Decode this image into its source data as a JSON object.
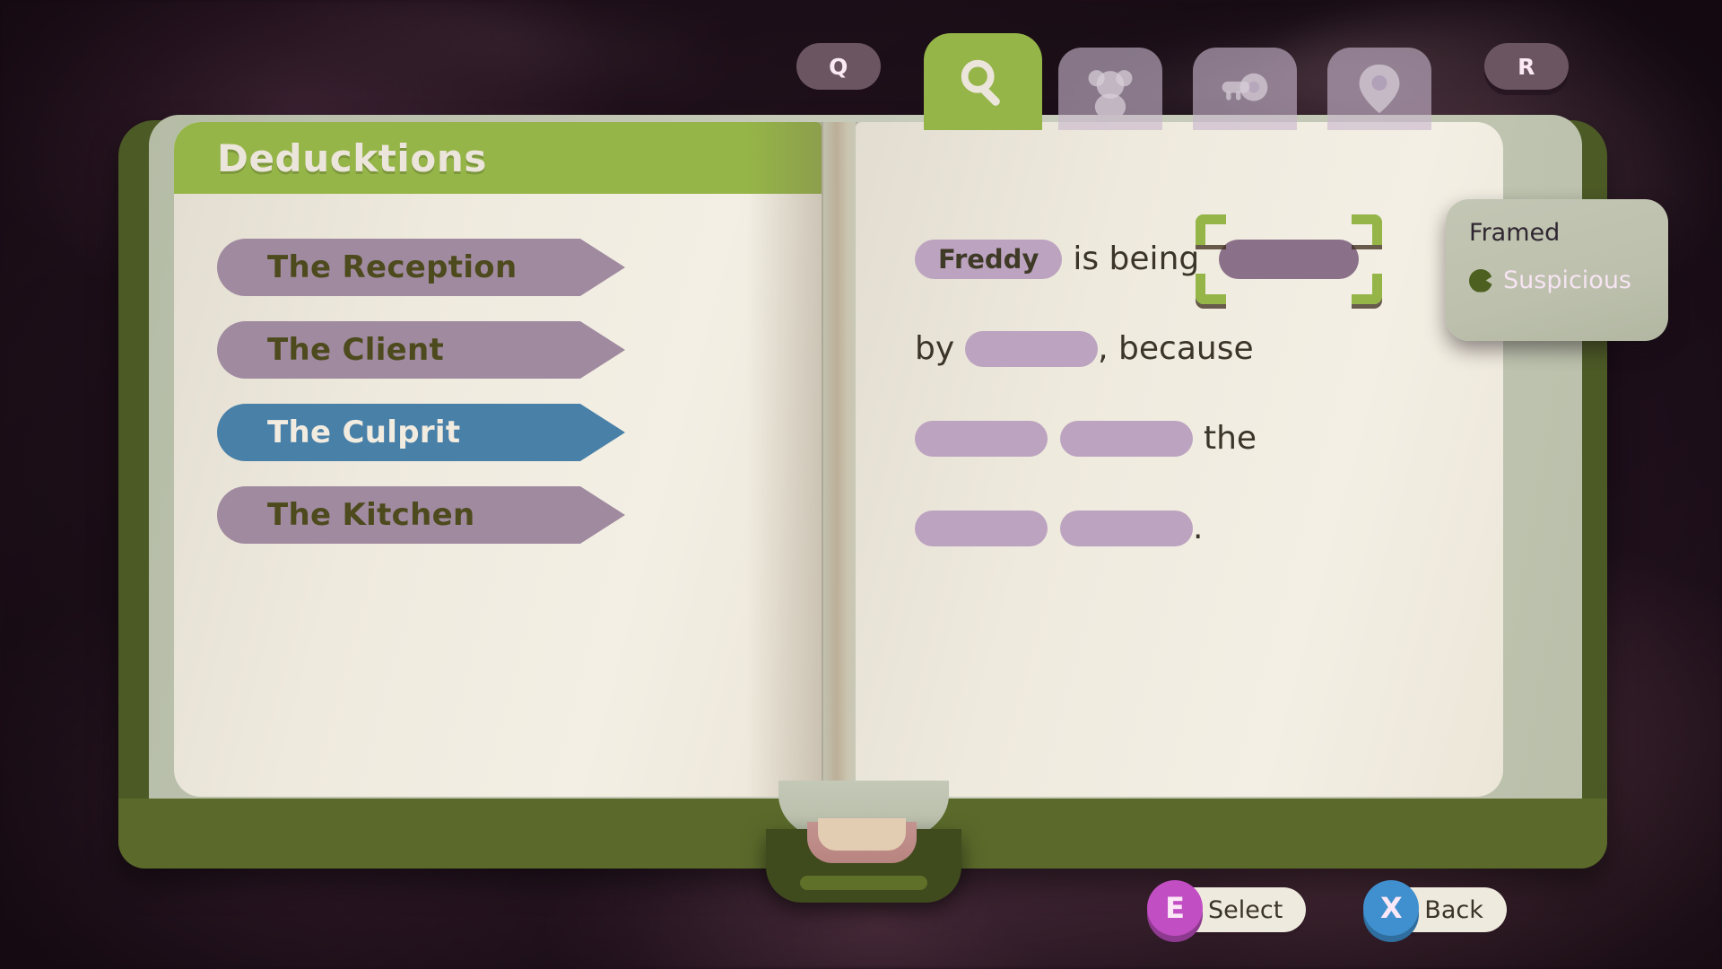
{
  "hud": {
    "left_key": "Q",
    "right_key": "R",
    "tabs": [
      {
        "id": "search",
        "icon": "magnifier-icon",
        "active": true
      },
      {
        "id": "suspects",
        "icon": "teddy-bear-icon",
        "active": false
      },
      {
        "id": "evidence",
        "icon": "key-icon",
        "active": false
      },
      {
        "id": "places",
        "icon": "map-pin-icon",
        "active": false
      }
    ]
  },
  "book": {
    "left_page": {
      "title": "Deducktions",
      "items": [
        {
          "label": "The Reception",
          "selected": false
        },
        {
          "label": "The Client",
          "selected": false
        },
        {
          "label": "The Culprit",
          "selected": true
        },
        {
          "label": "The Kitchen",
          "selected": false
        }
      ]
    },
    "right_page": {
      "line1": {
        "chip": "Freddy",
        "word": "is being",
        "slot_state": "selected"
      },
      "line2": {
        "word_before": "by",
        "punct": ", because"
      },
      "line3": {
        "word_after": "the"
      },
      "line4": {
        "punct": "."
      }
    }
  },
  "tooltip": {
    "title": "Framed",
    "tag": "Suspicious",
    "tag_icon": "speech-bubble-icon"
  },
  "prompts": [
    {
      "key": "E",
      "label": "Select",
      "color": "#c24ec4"
    },
    {
      "key": "X",
      "label": "Back",
      "color": "#4090cf"
    }
  ],
  "colors": {
    "accent_green": "#95b548",
    "selected_blue": "#4980a8",
    "chip_purple": "#bca3c0",
    "page_cream": "#efeade",
    "book_green": "#4c5a26"
  }
}
